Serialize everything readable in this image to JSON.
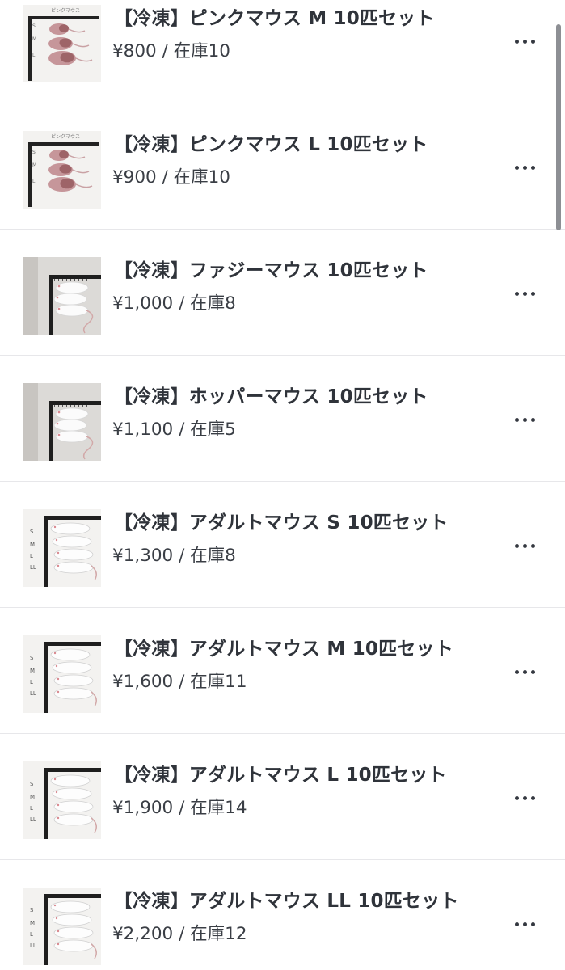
{
  "products": [
    {
      "title": "【冷凍】ピンクマウス M 10匹セット",
      "meta": "¥800 / 在庫10",
      "thumb_type": "pink",
      "thumb_header": "ピンクマウス",
      "thumb_labels": [
        "S",
        "M",
        "L"
      ],
      "more_icon": "more-horizontal-icon"
    },
    {
      "title": "【冷凍】ピンクマウス L 10匹セット",
      "meta": "¥900 / 在庫10",
      "thumb_type": "pink",
      "thumb_header": "ピンクマウス",
      "thumb_labels": [
        "S",
        "M",
        "L"
      ],
      "more_icon": "more-horizontal-icon"
    },
    {
      "title": "【冷凍】ファジーマウス 10匹セット",
      "meta": "¥1,000 / 在庫8",
      "thumb_type": "fuzzy",
      "thumb_header": "",
      "thumb_labels": [],
      "more_icon": "more-horizontal-icon"
    },
    {
      "title": "【冷凍】ホッパーマウス 10匹セット",
      "meta": "¥1,100 / 在庫5",
      "thumb_type": "fuzzy",
      "thumb_header": "",
      "thumb_labels": [],
      "more_icon": "more-horizontal-icon"
    },
    {
      "title": "【冷凍】アダルトマウス S 10匹セット",
      "meta": "¥1,300 / 在庫8",
      "thumb_type": "adult",
      "thumb_header": "",
      "thumb_labels": [
        "S",
        "M",
        "L",
        "LL"
      ],
      "more_icon": "more-horizontal-icon"
    },
    {
      "title": "【冷凍】アダルトマウス M 10匹セット",
      "meta": "¥1,600 / 在庫11",
      "thumb_type": "adult",
      "thumb_header": "",
      "thumb_labels": [
        "S",
        "M",
        "L",
        "LL"
      ],
      "more_icon": "more-horizontal-icon"
    },
    {
      "title": "【冷凍】アダルトマウス L 10匹セット",
      "meta": "¥1,900 / 在庫14",
      "thumb_type": "adult",
      "thumb_header": "",
      "thumb_labels": [
        "S",
        "M",
        "L",
        "LL"
      ],
      "more_icon": "more-horizontal-icon"
    },
    {
      "title": "【冷凍】アダルトマウス LL 10匹セット",
      "meta": "¥2,200 / 在庫12",
      "thumb_type": "adult",
      "thumb_header": "",
      "thumb_labels": [
        "S",
        "M",
        "L",
        "LL"
      ],
      "more_icon": "more-horizontal-icon"
    }
  ],
  "colors": {
    "divider": "#e7e7ea",
    "title_text": "#2f333a",
    "meta_text": "#3a3e45",
    "scrollbar": "#8d8f94"
  }
}
